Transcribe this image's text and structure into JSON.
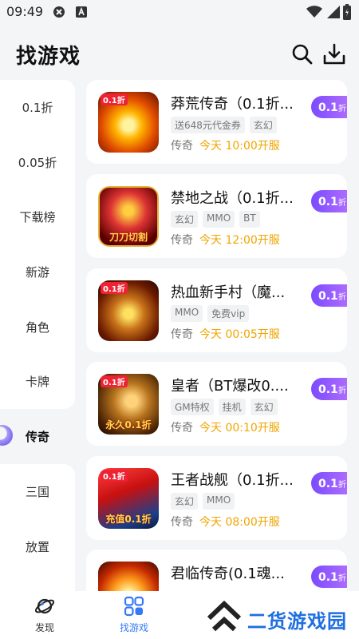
{
  "status": {
    "time": "09:49"
  },
  "header": {
    "title": "找游戏"
  },
  "sidebar": {
    "items": [
      {
        "label": "0.1折"
      },
      {
        "label": "0.05折"
      },
      {
        "label": "下载榜"
      },
      {
        "label": "新游"
      },
      {
        "label": "角色"
      },
      {
        "label": "卡牌"
      },
      {
        "label": "传奇",
        "active": true
      },
      {
        "label": "三国"
      },
      {
        "label": "放置"
      }
    ]
  },
  "games": [
    {
      "title": "莽荒传奇（0.1折...",
      "tags": [
        "送648元代金券",
        "玄幻"
      ],
      "genre": "传奇",
      "open_time": "今天 10:00开服",
      "discount_num": "0.1",
      "discount_unit": "折",
      "thumb_tag": "0.1折"
    },
    {
      "title": "禁地之战（0.1折...",
      "tags": [
        "玄幻",
        "MMO",
        "BT"
      ],
      "genre": "传奇",
      "open_time": "今天 12:00开服",
      "discount_num": "0.1",
      "discount_unit": "折",
      "thumb_caption": "刀刀切割"
    },
    {
      "title": "热血新手村（魔...",
      "tags": [
        "MMO",
        "免费vip"
      ],
      "genre": "传奇",
      "open_time": "今天 00:05开服",
      "discount_num": "0.1",
      "discount_unit": "折",
      "thumb_tag": "0.1折"
    },
    {
      "title": "皇者（BT爆改0....",
      "tags": [
        "GM特权",
        "挂机",
        "玄幻"
      ],
      "genre": "传奇",
      "open_time": "今天 00:10开服",
      "discount_num": "0.1",
      "discount_unit": "折",
      "thumb_tag": "0.1折",
      "thumb_caption": "永久0.1折"
    },
    {
      "title": "王者战舰（0.1折...",
      "tags": [
        "玄幻",
        "MMO"
      ],
      "genre": "传奇",
      "open_time": "今天 08:00开服",
      "discount_num": "0.1",
      "discount_unit": "折",
      "thumb_tag": "0.1折",
      "thumb_caption": "充值0.1折"
    },
    {
      "title": "君临传奇(0.1魂...",
      "tags": [],
      "genre": "",
      "open_time": "",
      "discount_num": "0.1",
      "discount_unit": "折"
    }
  ],
  "bottom_nav": [
    {
      "label": "发现",
      "icon": "planet-icon"
    },
    {
      "label": "找游戏",
      "icon": "grid-icon",
      "active": true
    }
  ],
  "watermark": {
    "text": "二货游戏园"
  },
  "colors": {
    "accent": "#3478f6",
    "open_time": "#f0a500",
    "discount_from": "#7b4bff",
    "discount_to": "#c87dff",
    "watermark": "#1f6fe0"
  }
}
